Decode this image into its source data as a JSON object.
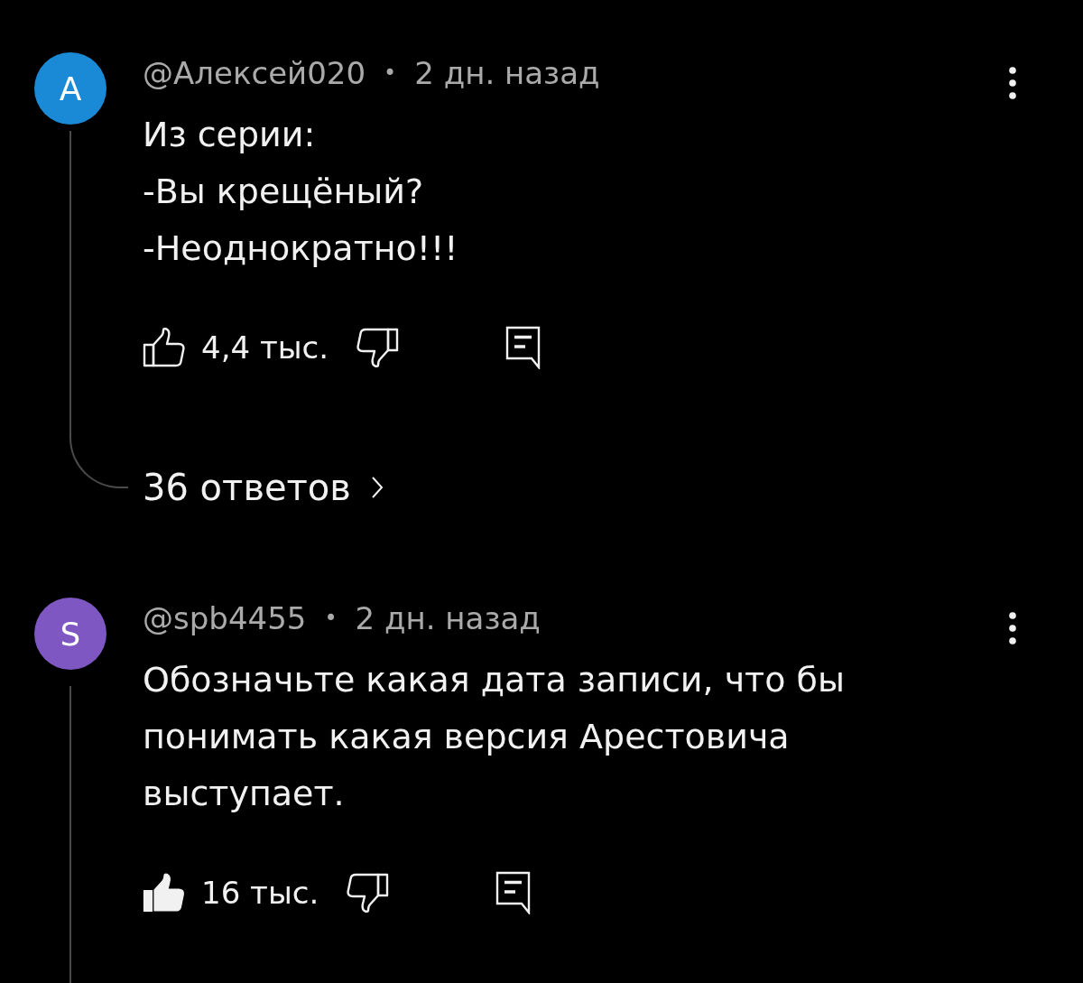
{
  "comments": [
    {
      "avatar": {
        "letter": "A",
        "color": "#1b8ad6"
      },
      "author": "@Алексей020",
      "separator": "•",
      "time": "2 дн. назад",
      "text": "Из серии:\n-Вы крещёный?\n-Неоднократно!!!",
      "liked": false,
      "likes": "4,4 тыс.",
      "replies": "36 ответов"
    },
    {
      "avatar": {
        "letter": "S",
        "color": "#7e57c2"
      },
      "author": "@spb4455",
      "separator": "•",
      "time": "2 дн. назад",
      "text": "Обозначьте какая дата записи, что бы понимать какая версия Арестовича выступает.",
      "liked": true,
      "likes": "16 тыс."
    }
  ]
}
